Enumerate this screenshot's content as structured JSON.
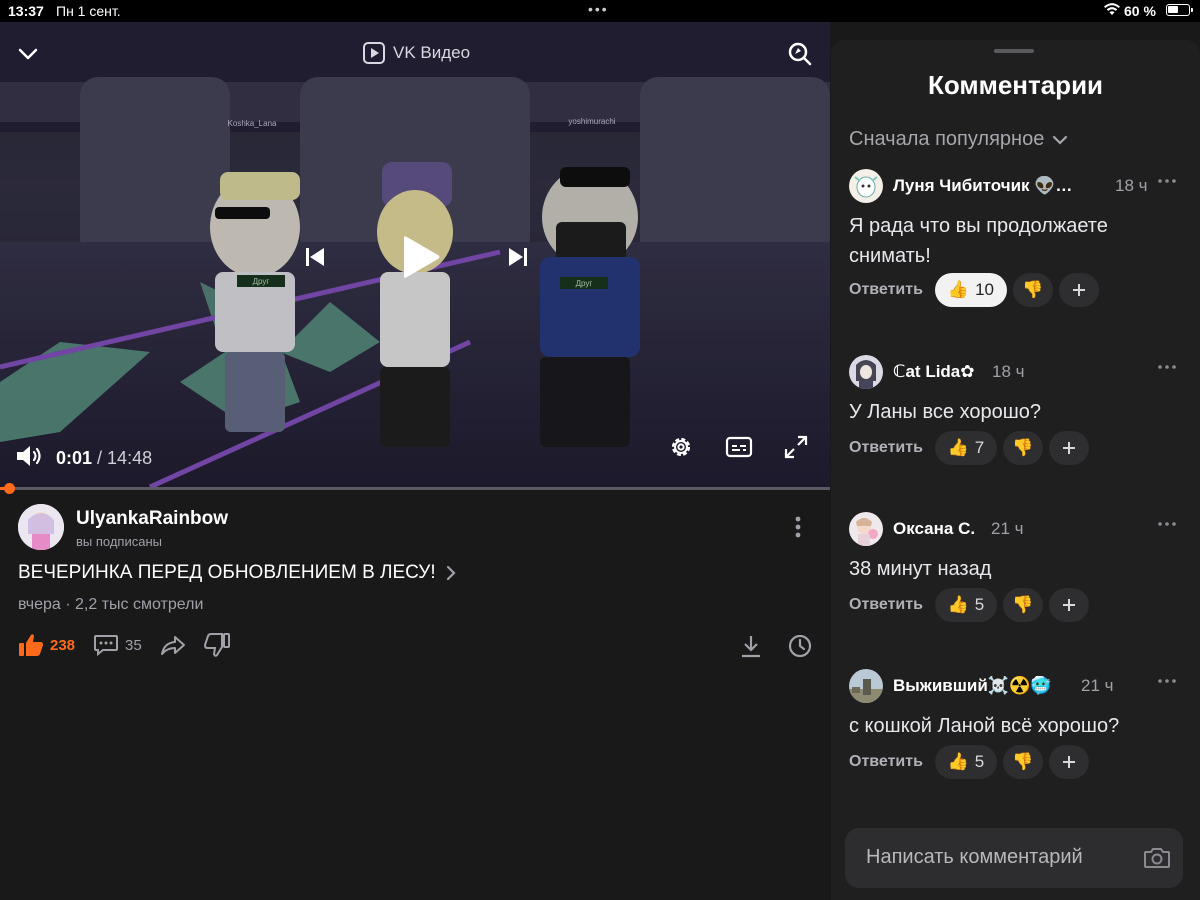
{
  "status_bar": {
    "time": "13:37",
    "date": "Пн 1 сент.",
    "battery": "60 %",
    "battery_level": 0.6
  },
  "player": {
    "brand": "VK Видео",
    "current_time": "0:01",
    "duration": "14:48",
    "progress": 0.0011,
    "in_video_names": [
      "Koshka_Lana",
      "yoshimurachi"
    ],
    "badges": [
      "Друг",
      "Друг"
    ]
  },
  "video": {
    "channel_name": "UlyankaRainbow",
    "subscription_status": "вы подписаны",
    "title": "ВЕЧЕРИНКА ПЕРЕД ОБНОВЛЕНИЕМ В ЛЕСУ!",
    "meta": "вчера · 2,2 тыс смотрели",
    "likes": "238",
    "comments_count": "35"
  },
  "comments_panel": {
    "title": "Комментарии",
    "sort_label": "Сначала популярное",
    "reply_label": "Ответить",
    "composer_placeholder": "Написать комментарий",
    "comments": [
      {
        "author": "Луня Чибиточик 👽…",
        "time": "18 ч",
        "text": "Я рада что вы продолжаете снимать!",
        "likes": "10",
        "liked": true
      },
      {
        "author": "ℂat Lida✿",
        "time": "18 ч",
        "text": "У Ланы все хорошо?",
        "likes": "7",
        "liked": false
      },
      {
        "author": "Оксана С.",
        "time": "21 ч",
        "text": "38 минут назад",
        "likes": "5",
        "liked": false
      },
      {
        "author": "Выживший☠️☢️🥶",
        "time": "21 ч",
        "text": "с кошкой Ланой всё хорошо?",
        "likes": "5",
        "liked": false
      }
    ]
  },
  "colors": {
    "accent": "#ff6b1a",
    "background": "#19191a",
    "panel": "#1f1f20",
    "pill": "#2e2e30"
  }
}
